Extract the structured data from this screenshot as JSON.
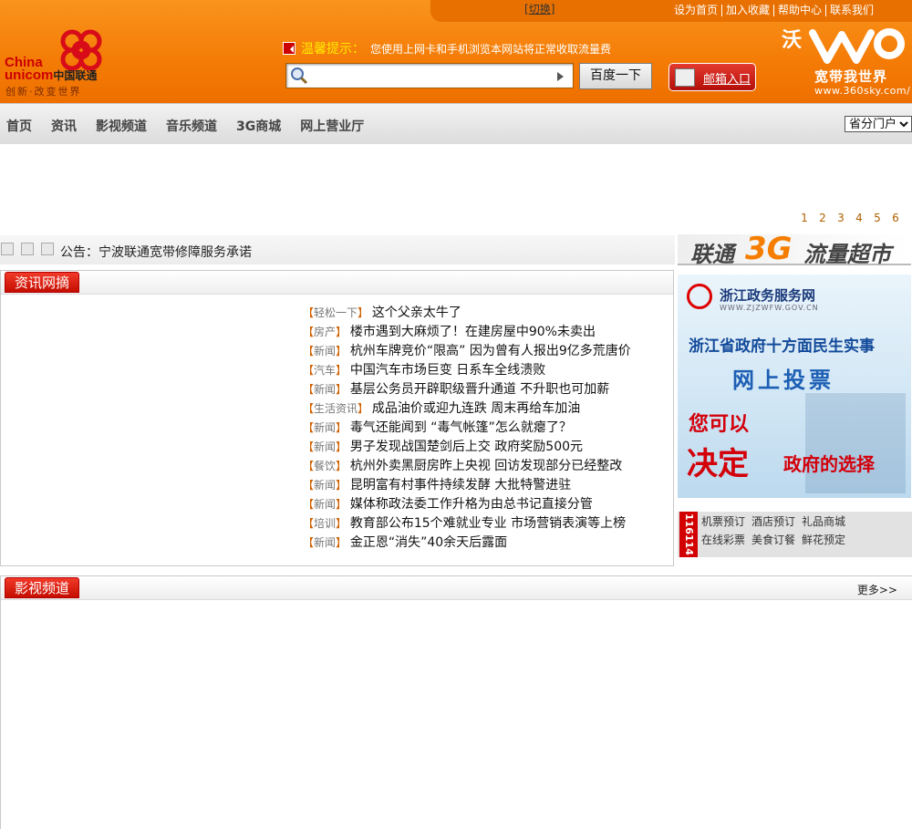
{
  "header": {
    "switch_label": "切换",
    "top_links": [
      "设为首页",
      "加入收藏",
      "帮助中心",
      "联系我们"
    ],
    "logo": {
      "en": "China unicom",
      "cn": "中国联通",
      "slogan": "创新·改变世界"
    },
    "tip_label": "温馨提示：",
    "tip_text": "您使用上网卡和手机浏览本网站将正常收取流量费",
    "search_placeholder": "",
    "search_button": "百度一下",
    "mail_button": "邮箱入口",
    "brand": {
      "wo": "沃",
      "tagline": "宽带我世界",
      "url": "www.360sky.com/"
    },
    "colors": {
      "orange": "#f47b06",
      "red": "#c50d00"
    }
  },
  "nav": {
    "items": [
      "首页",
      "资讯",
      "影视频道",
      "音乐频道",
      "3G商城",
      "网上营业厅"
    ],
    "province_select": "省分门户"
  },
  "banner": {
    "pages": [
      "1",
      "2",
      "3",
      "4",
      "5",
      "6"
    ]
  },
  "notice": {
    "label": "公告：",
    "text": "宁波联通宽带修障服务承诺"
  },
  "news": {
    "title": "资讯网摘",
    "items": [
      {
        "cat": "轻松一下",
        "title": "这个父亲太牛了"
      },
      {
        "cat": "房产",
        "title": "楼市遇到大麻烦了！在建房屋中90%未卖出"
      },
      {
        "cat": "新闻",
        "title": "杭州车牌竞价“限高”  因为曾有人报出9亿多荒唐价"
      },
      {
        "cat": "汽车",
        "title": "中国汽车市场巨变 日系车全线溃败"
      },
      {
        "cat": "新闻",
        "title": "基层公务员开辟职级晋升通道 不升职也可加薪"
      },
      {
        "cat": "生活资讯",
        "title": "成品油价或迎九连跌 周末再给车加油"
      },
      {
        "cat": "新闻",
        "title": "毒气还能闻到 “毒气帐篷”怎么就瘪了？"
      },
      {
        "cat": "新闻",
        "title": "男子发现战国楚剑后上交 政府奖励500元"
      },
      {
        "cat": "餐饮",
        "title": "杭州外卖黑厨房昨上央视 回访发现部分已经整改"
      },
      {
        "cat": "新闻",
        "title": "昆明富有村事件持续发酵 大批特警进驻"
      },
      {
        "cat": "新闻",
        "title": "媒体称政法委工作升格为由总书记直接分管"
      },
      {
        "cat": "培训",
        "title": "教育部公布15个难就业专业 市场营销表演等上榜"
      },
      {
        "cat": "新闻",
        "title": "金正恩“消失”40余天后露面"
      }
    ]
  },
  "right": {
    "ad3g": {
      "a": "联通",
      "b": "3G",
      "c": "流量超市"
    },
    "zj": {
      "site": "浙江政务服务网",
      "domain": "WWW.ZJZWFW.GOV.CN",
      "line1": "浙江省政府十方面民生实事",
      "line2": "网上投票",
      "line3": "您可以",
      "line4a": "决定",
      "line4b": "政府的选择"
    },
    "service": {
      "number": "116114",
      "row1": [
        "机票预订",
        "酒店预订",
        "礼品商城"
      ],
      "row2": [
        "在线彩票",
        "美食订餐",
        "鲜花预定"
      ]
    }
  },
  "video": {
    "title": "影视频道",
    "more": "更多>>"
  }
}
